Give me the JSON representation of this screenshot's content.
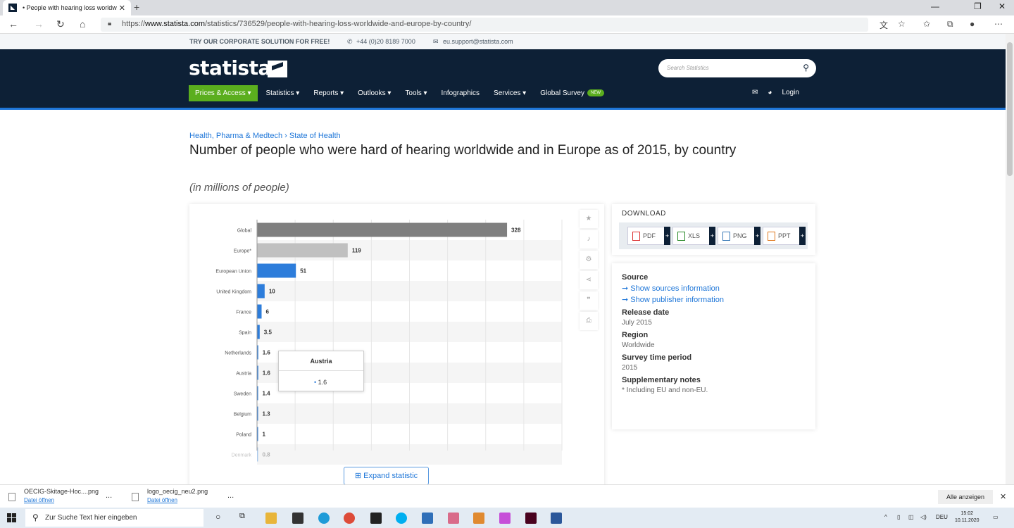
{
  "browser": {
    "tab_title": "• People with hearing loss worldw",
    "tab_close": "✕",
    "new_tab": "+",
    "url_prefix": "https://",
    "url_domain": "www.statista.com",
    "url_path": "/statistics/736529/people-with-hearing-loss-worldwide-and-europe-by-country/"
  },
  "topstrip": {
    "corporate": "TRY OUR CORPORATE SOLUTION FOR FREE!",
    "phone": "+44 (0)20 8189 7000",
    "email": "eu.support@statista.com"
  },
  "header": {
    "logo": "statista",
    "search_placeholder": "Search Statistics",
    "nav": [
      "Prices & Access ▾",
      "Statistics ▾",
      "Reports ▾",
      "Outlooks ▾",
      "Tools ▾",
      "Infographics",
      "Services ▾",
      "Global Survey"
    ],
    "new_badge": "NEW",
    "login": "Login"
  },
  "page": {
    "breadcrumb_1": "Health, Pharma & Medtech",
    "breadcrumb_sep": "›",
    "breadcrumb_2": "State of Health",
    "title": "Number of people who were hard of hearing worldwide and in Europe as of 2015, by country",
    "subtitle": "(in millions of people)",
    "expand": "Expand statistic"
  },
  "chart_data": {
    "type": "bar",
    "orientation": "horizontal",
    "categories": [
      "Global",
      "Europe*",
      "European Union",
      "United Kingdom",
      "France",
      "Spain",
      "Netherlands",
      "Austria",
      "Sweden",
      "Belgium",
      "Poland",
      "Denmark"
    ],
    "values": [
      328,
      119,
      51,
      10,
      6,
      3.5,
      1.6,
      1.6,
      1.4,
      1.3,
      1,
      0.8
    ],
    "value_labels": [
      "328",
      "119",
      "51",
      "10",
      "6",
      "3.5",
      "1.6",
      "1.6",
      "1.4",
      "1.3",
      "1",
      "0.8"
    ],
    "colors": [
      "#7f7f7f",
      "#c0c0c0",
      "#2d7ddb",
      "#2d7ddb",
      "#2d7ddb",
      "#2d7ddb",
      "#2d7ddb",
      "#2d7ddb",
      "#2d7ddb",
      "#2d7ddb",
      "#2d7ddb",
      "#2d7ddb"
    ],
    "xlim": [
      0,
      400
    ],
    "grid": true,
    "tooltip": {
      "title": "Austria",
      "value": "1.6"
    }
  },
  "download": {
    "title": "DOWNLOAD",
    "formats": [
      "PDF",
      "XLS",
      "PNG",
      "PPT"
    ],
    "plus": "+"
  },
  "info": {
    "source_h": "Source",
    "source_link": "➞ Show sources information",
    "publisher_link": "➞ Show publisher information",
    "release_h": "Release date",
    "release_v": "July 2015",
    "region_h": "Region",
    "region_v": "Worldwide",
    "survey_h": "Survey time period",
    "survey_v": "2015",
    "notes_h": "Supplementary notes",
    "notes_v": "* Including EU and non-EU."
  },
  "downloads_bar": {
    "file1": "OECIG-Skitage-Hoc....png",
    "file2": "logo_oecig_neu2.png",
    "open": "Datei öffnen",
    "more": "...",
    "show_all": "Alle anzeigen",
    "close": "✕"
  },
  "taskbar": {
    "search": "Zur Suche Text hier eingeben",
    "lang": "DEU",
    "time": "15:02",
    "date": "10.11.2020"
  }
}
